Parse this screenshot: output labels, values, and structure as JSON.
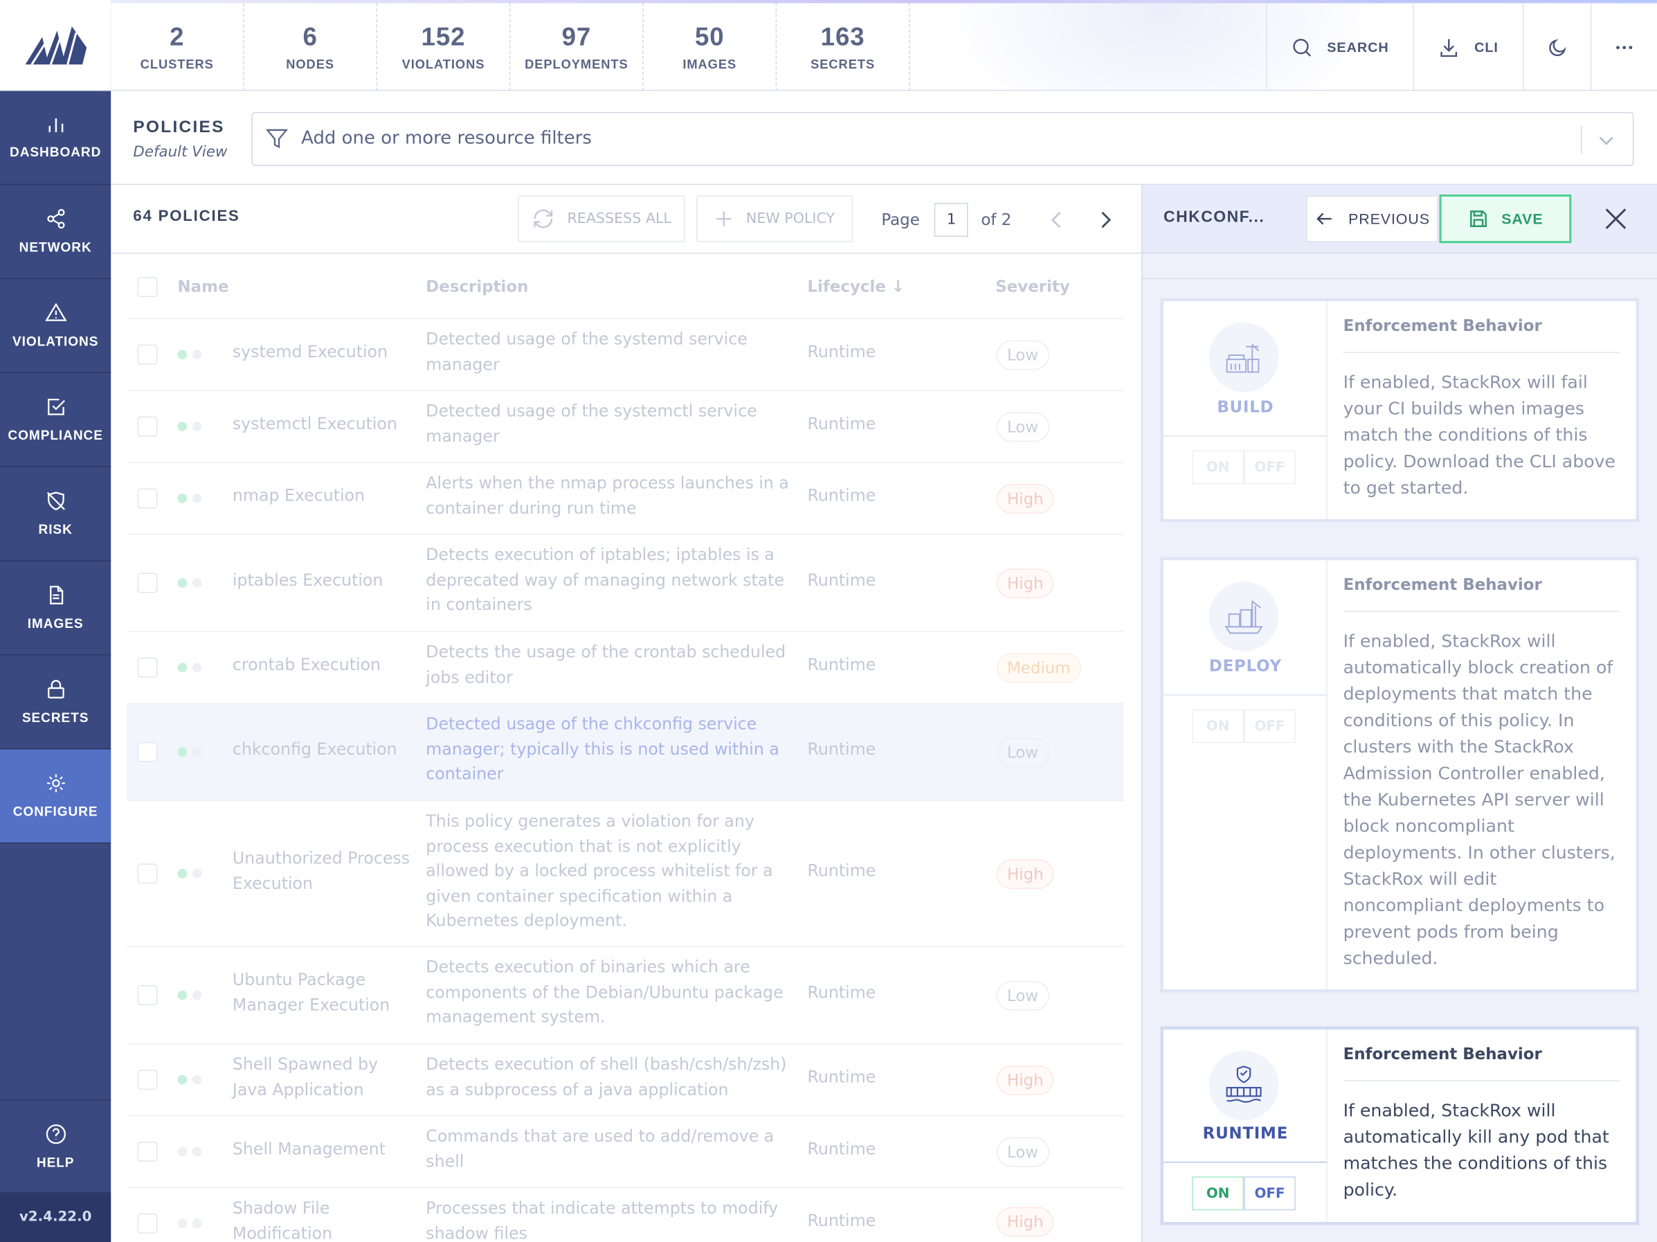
{
  "app": {
    "version": "v2.4.22.0"
  },
  "sidebar": {
    "items": [
      {
        "label": "DASHBOARD",
        "icon": "bar-chart-icon"
      },
      {
        "label": "NETWORK",
        "icon": "share-icon"
      },
      {
        "label": "VIOLATIONS",
        "icon": "alert-triangle-icon"
      },
      {
        "label": "COMPLIANCE",
        "icon": "check-square-icon"
      },
      {
        "label": "RISK",
        "icon": "shield-off-icon"
      },
      {
        "label": "IMAGES",
        "icon": "file-icon"
      },
      {
        "label": "SECRETS",
        "icon": "lock-icon"
      },
      {
        "label": "CONFIGURE",
        "icon": "settings-icon",
        "active": true
      }
    ],
    "help": "HELP"
  },
  "summary": [
    {
      "count": "2",
      "label": "CLUSTERS"
    },
    {
      "count": "6",
      "label": "NODES"
    },
    {
      "count": "152",
      "label": "VIOLATIONS"
    },
    {
      "count": "97",
      "label": "DEPLOYMENTS"
    },
    {
      "count": "50",
      "label": "IMAGES"
    },
    {
      "count": "163",
      "label": "SECRETS"
    }
  ],
  "topnav": {
    "search": "SEARCH",
    "cli": "CLI"
  },
  "header": {
    "title": "POLICIES",
    "subtitle": "Default View",
    "filter_placeholder": "Add one or more resource filters"
  },
  "list": {
    "count_label": "64 POLICIES",
    "reassess": "REASSESS ALL",
    "new_policy": "NEW POLICY",
    "page_label": "Page",
    "page": "1",
    "of_label": "of 2",
    "columns": {
      "name": "Name",
      "description": "Description",
      "lifecycle": "Lifecycle ↓",
      "severity": "Severity"
    },
    "rows": [
      {
        "name": "systemd Execution",
        "description": "Detected usage of the systemd service manager",
        "lifecycle": "Runtime",
        "severity": "Low"
      },
      {
        "name": "systemctl Execution",
        "description": "Detected usage of the systemctl service manager",
        "lifecycle": "Runtime",
        "severity": "Low"
      },
      {
        "name": "nmap Execution",
        "description": "Alerts when the nmap process launches in a container during run time",
        "lifecycle": "Runtime",
        "severity": "High"
      },
      {
        "name": "iptables Execution",
        "description": "Detects execution of iptables; iptables is a deprecated way of managing network state in containers",
        "lifecycle": "Runtime",
        "severity": "High"
      },
      {
        "name": "crontab Execution",
        "description": "Detects the usage of the crontab scheduled jobs editor",
        "lifecycle": "Runtime",
        "severity": "Medium"
      },
      {
        "name": "chkconfig Execution",
        "description": "Detected usage of the chkconfig service manager; typically this is not used within a container",
        "lifecycle": "Runtime",
        "severity": "Low"
      },
      {
        "name": "Unauthorized Process Execution",
        "description": "This policy generates a violation for any process execution that is not explicitly allowed by a locked process whitelist for a given container specification within a Kubernetes deployment.",
        "lifecycle": "Runtime",
        "severity": "High"
      },
      {
        "name": "Ubuntu Package Manager Execution",
        "description": "Detects execution of binaries which are components of the Debian/Ubuntu package management system.",
        "lifecycle": "Runtime",
        "severity": "Low"
      },
      {
        "name": "Shell Spawned by Java Application",
        "description": "Detects execution of shell (bash/csh/sh/zsh) as a subprocess of a java application",
        "lifecycle": "Runtime",
        "severity": "High"
      },
      {
        "name": "Shell Management",
        "description": "Commands that are used to add/remove a shell",
        "lifecycle": "Runtime",
        "severity": "Low"
      },
      {
        "name": "Shadow File Modification",
        "description": "Processes that indicate attempts to modify shadow files",
        "lifecycle": "Runtime",
        "severity": "High"
      }
    ]
  },
  "panel": {
    "title": "CHKCONF...",
    "previous": "PREVIOUS",
    "save": "SAVE",
    "cards": [
      {
        "stage": "BUILD",
        "heading": "Enforcement Behavior",
        "text": "If enabled, StackRox will fail your CI builds when images match the conditions of this policy. Download the CLI above to get started.",
        "on": "ON",
        "off": "OFF",
        "enabled": false
      },
      {
        "stage": "DEPLOY",
        "heading": "Enforcement Behavior",
        "text": "If enabled, StackRox will automatically block creation of deployments that match the conditions of this policy. In clusters with the StackRox Admission Controller enabled, the Kubernetes API server will block noncompliant deployments. In other clusters, StackRox will edit noncompliant deployments to prevent pods from being scheduled.",
        "on": "ON",
        "off": "OFF",
        "enabled": false
      },
      {
        "stage": "RUNTIME",
        "heading": "Enforcement Behavior",
        "text": "If enabled, StackRox will automatically kill any pod that matches the conditions of this policy.",
        "on": "ON",
        "off": "OFF",
        "enabled": true
      }
    ]
  },
  "colors": {
    "sidebar": "#3a4a80",
    "active_nav": "#5471c6",
    "save_green": "#4fcf94"
  }
}
